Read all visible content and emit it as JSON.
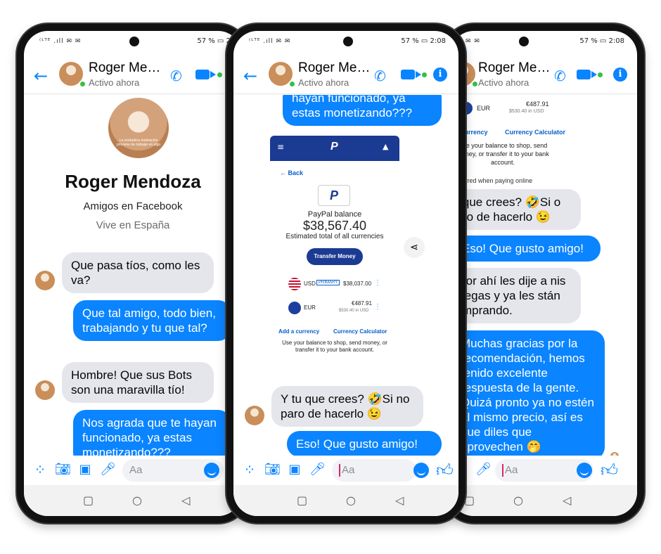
{
  "contact": {
    "short_name": "Roger Me…",
    "status": "Activo ahora",
    "full_name": "Roger Mendoza",
    "friends_line": "Amigos en Facebook",
    "location": "Vive en España",
    "profile_caption": "La verdadera motivación proviene de trabajar en algo"
  },
  "status_bar": {
    "signals": "⁽ᴸᵀᴱ .ıll ✉ ✉",
    "battery_1": "57 % ▭ 2:07",
    "battery_2": "57 % ▭ 2:08",
    "battery_3": "57 % ▭ 2:08"
  },
  "composer": {
    "placeholder": "Aa"
  },
  "phone1": {
    "messages": [
      {
        "from": "in",
        "text": "Que pasa tíos, como les va?"
      },
      {
        "from": "out",
        "text": "Que tal amigo, todo bien, trabajando y tu que tal?"
      },
      {
        "from": "in",
        "text": "Hombre! Que sus Bots son una maravilla tío!"
      },
      {
        "from": "out",
        "text": "Nos agrada que te hayan funcionado, ya estas monetizando???"
      }
    ]
  },
  "phone2": {
    "messages": [
      {
        "from": "out",
        "text": "hayan funcionado, ya estas monetizando???"
      },
      {
        "from": "in",
        "text": "Y tu que crees? 🤣Si no paro de hacerlo 😉"
      },
      {
        "from": "out",
        "text": "Eso! Que gusto amigo!"
      }
    ],
    "paypal": {
      "back": "Back",
      "balance_label": "PayPal balance",
      "balance": "$38,567.40",
      "estimated": "Estimated total of all currencies",
      "transfer_button": "Transfer Money",
      "currencies": [
        {
          "code": "USD",
          "badge": "PRIMARY",
          "amount": "$38,037.00",
          "sub": ""
        },
        {
          "code": "EUR",
          "badge": "",
          "amount": "€487.91",
          "sub": "$530.40 in USD"
        }
      ],
      "add_currency": "Add a currency",
      "calculator": "Currency Calculator",
      "note": "Use your balance to shop, send money, or transfer it to your bank account.",
      "preferred": "Preferred when paying online"
    }
  },
  "phone3": {
    "messages": [
      {
        "from": "in",
        "text": "tu que crees? 🤣Si o paro de hacerlo 😉"
      },
      {
        "from": "out",
        "text": "Eso! Que gusto amigo!"
      },
      {
        "from": "in",
        "text": "a por ahí les dije a nis colegas y ya les stán comprando."
      },
      {
        "from": "out",
        "text": "Muchas gracias por la recomendación, hemos tenido excelente respuesta de la gente. Quizá pronto ya no estén al mismo precio, así es que diles que aprovechen 🤭"
      }
    ],
    "paypal": {
      "eur": "EUR",
      "eur_amount": "€487.91",
      "eur_sub": "$530.40 in USD",
      "add_currency": "d a currency",
      "calculator": "Currency Calculator",
      "note": "Use your balance to shop, send money, or transfer it to your bank account.",
      "preferred": "Preferred when paying online"
    }
  },
  "colors": {
    "accent": "#0a84ff",
    "incoming": "#e4e6eb",
    "paypal_navy": "#1b3a92",
    "online": "#31c244"
  }
}
